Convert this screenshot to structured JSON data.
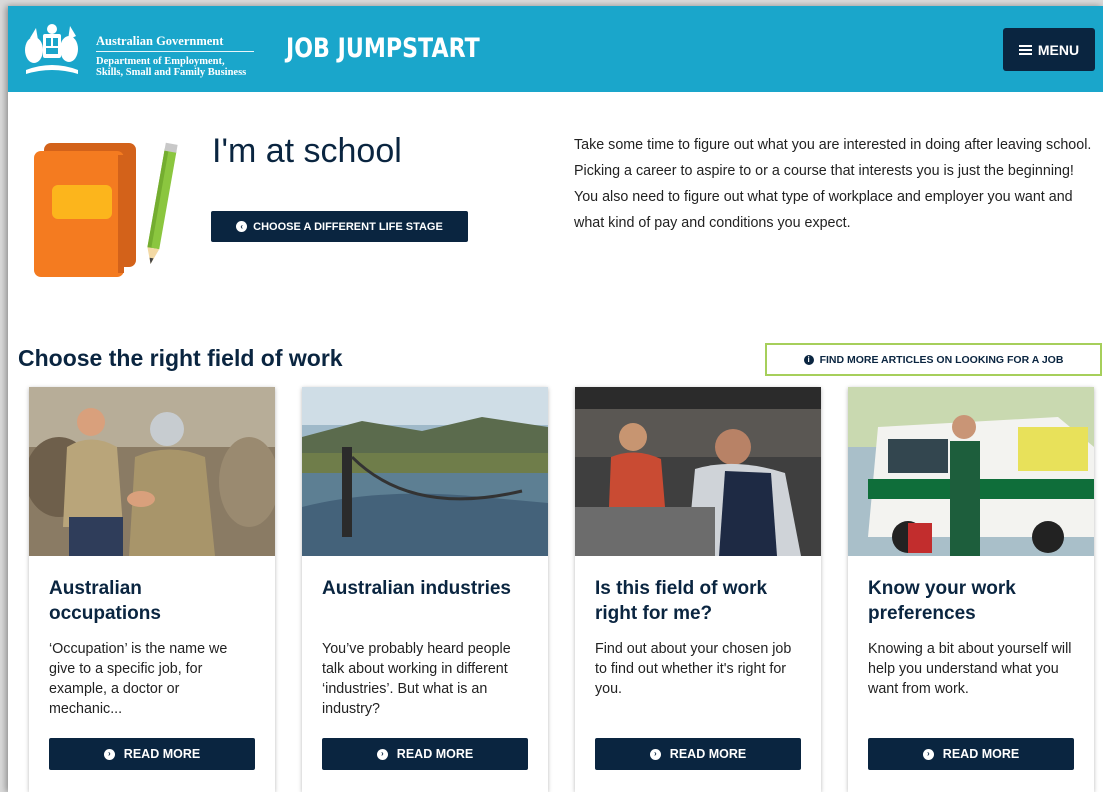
{
  "header": {
    "gov_name": "Australian Government",
    "dept_line1": "Department of Employment,",
    "dept_line2": "Skills, Small and Family Business",
    "brand": "JOB JUMPSTART",
    "menu_label": "MENU"
  },
  "hero": {
    "title": "I'm at school",
    "stage_button": "CHOOSE A DIFFERENT LIFE STAGE",
    "intro": "Take some time to figure out what you are interested in doing after leaving school. Picking a career to aspire to or a course that interests you is just the beginning! You also need to figure out what type of workplace and employer you want and what kind of pay and conditions you expect."
  },
  "section": {
    "title": "Choose the right field of work",
    "find_button": "FIND MORE ARTICLES ON LOOKING FOR A JOB"
  },
  "cards": [
    {
      "title": "Australian occupations",
      "desc": "‘Occupation’ is the name we give to a specific job, for example, a doctor or mechanic...",
      "button": "READ MORE"
    },
    {
      "title": "Australian industries",
      "desc": "You’ve probably heard people talk about working in different ‘industries’. But what is an industry?",
      "button": "READ MORE"
    },
    {
      "title": "Is this field of work right for me?",
      "desc": "Find out about your chosen job to find out whether it's right for you.",
      "button": "READ MORE"
    },
    {
      "title": "Know your work preferences",
      "desc": "Knowing a bit about yourself will help you understand what you want from work.",
      "button": "READ MORE"
    }
  ],
  "colors": {
    "header_bg": "#1aa6cb",
    "navy": "#0a2540",
    "book_orange": "#f47b20",
    "accent_green": "#a6cf5b"
  },
  "icons": {
    "menu": "hamburger-icon",
    "stage": "chevron-circle-left-icon",
    "find": "info-circle-icon",
    "read": "chevron-circle-right-icon"
  }
}
